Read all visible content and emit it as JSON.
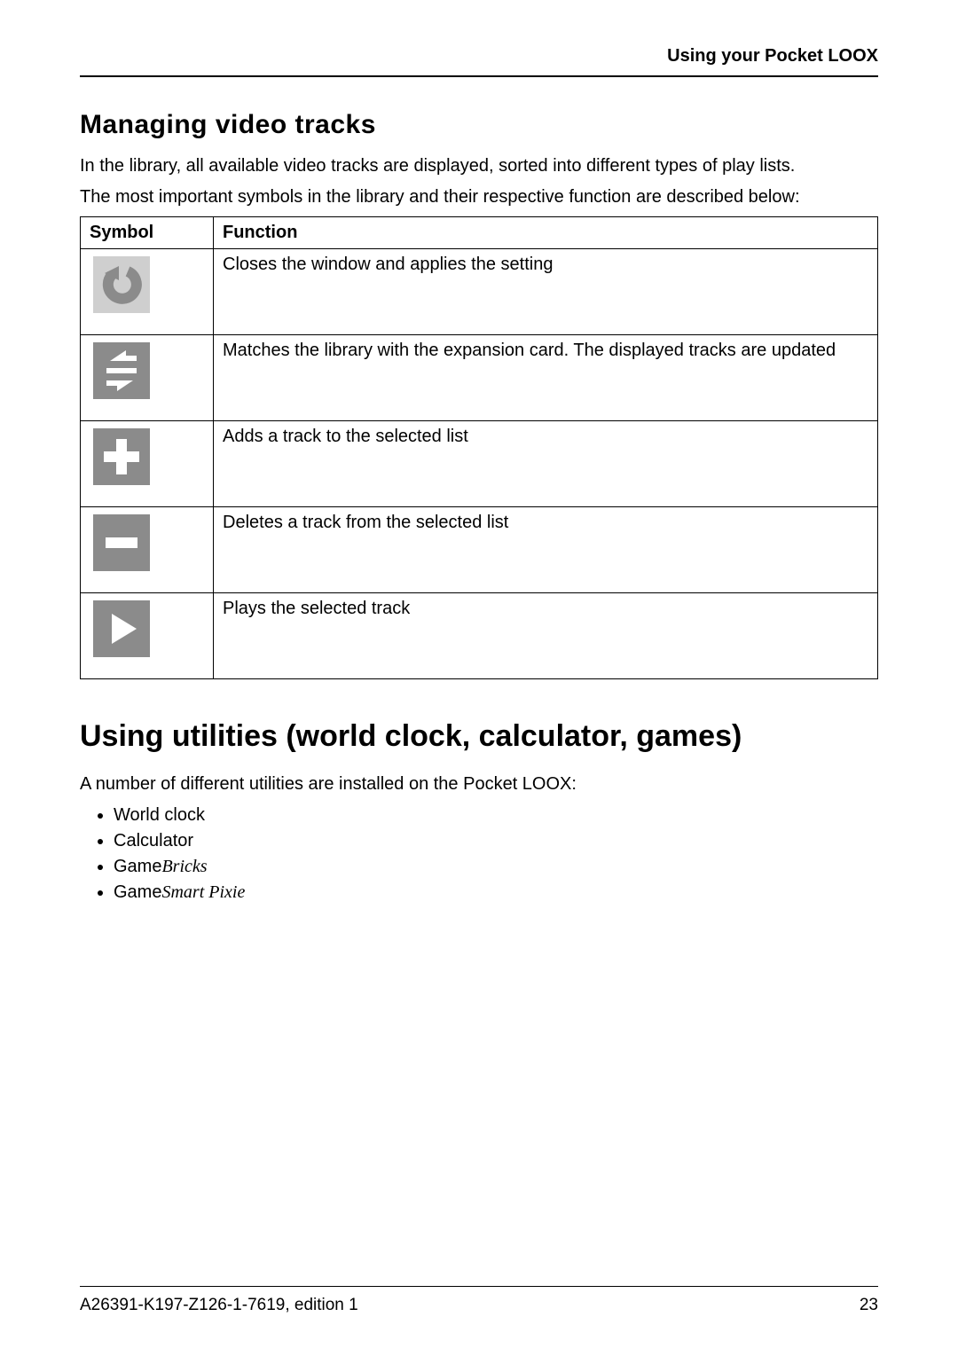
{
  "header": {
    "title": "Using your Pocket LOOX"
  },
  "section1": {
    "heading": "Managing video tracks",
    "para1": "In the library, all available video tracks are displayed, sorted into different types of play lists.",
    "para2": "The most important symbols in the library and their respective function are described below:"
  },
  "table": {
    "headers": {
      "symbol": "Symbol",
      "function": "Function"
    },
    "rows": [
      {
        "icon": "back-arrow-icon",
        "func": "Closes the window and applies the setting"
      },
      {
        "icon": "sync-icon",
        "func": "Matches the library with the expansion card. The displayed tracks are updated"
      },
      {
        "icon": "plus-icon",
        "func": "Adds a track to the selected list"
      },
      {
        "icon": "minus-icon",
        "func": "Deletes a track from the selected list"
      },
      {
        "icon": "play-icon",
        "func": "Plays the selected track"
      }
    ]
  },
  "section2": {
    "heading": "Using utilities (world clock, calculator, games)",
    "para": "A number of different utilities are installed on the Pocket LOOX:",
    "items": [
      {
        "label": "World clock",
        "italic": ""
      },
      {
        "label": "Calculator",
        "italic": ""
      },
      {
        "label": "Game",
        "italic": "Bricks"
      },
      {
        "label": "Game",
        "italic": "Smart Pixie"
      }
    ]
  },
  "footer": {
    "left": "A26391-K197-Z126-1-7619, edition 1",
    "right": "23"
  }
}
